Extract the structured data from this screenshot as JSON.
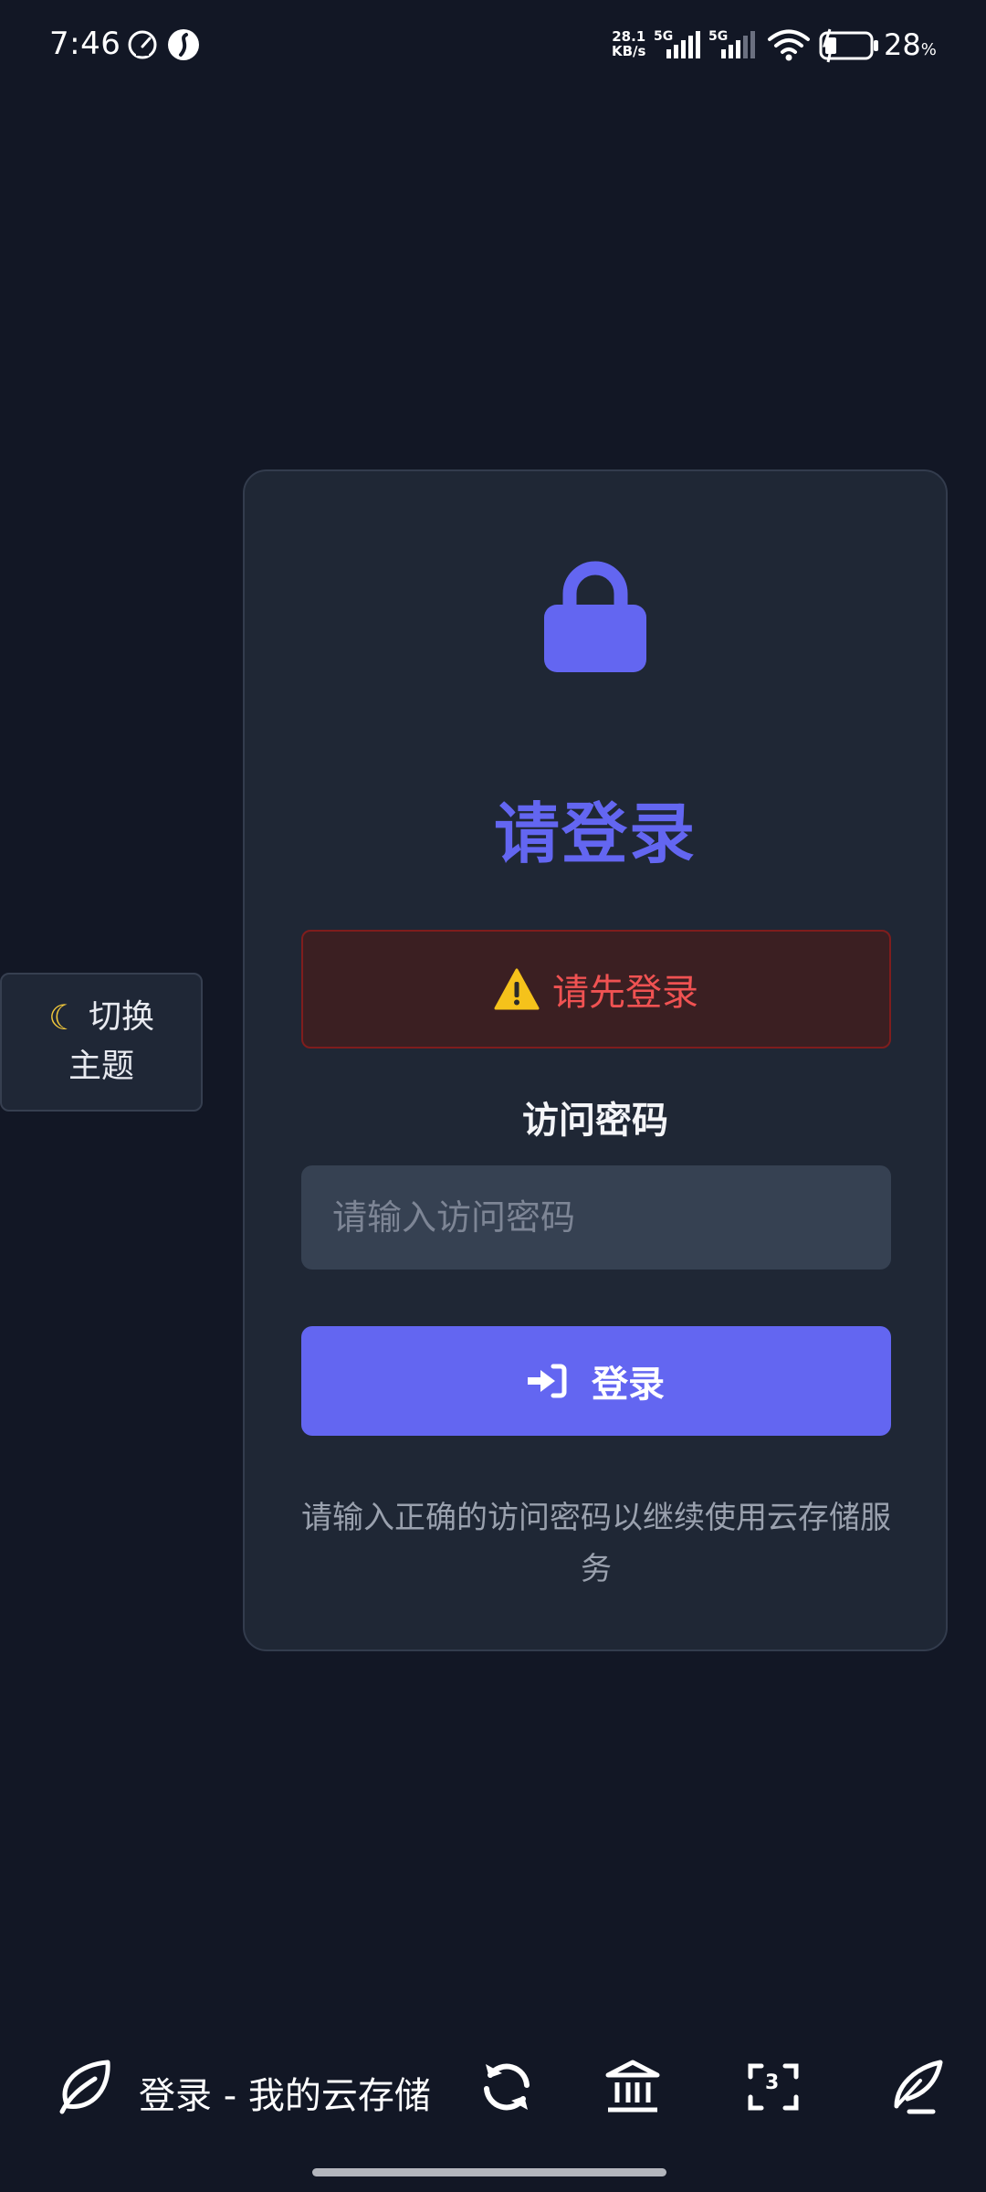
{
  "status_bar": {
    "time": "7:46",
    "net_speed_value": "28.1",
    "net_speed_unit": "KB/s",
    "sim1_label": "5G",
    "sim2_label": "5G",
    "battery_percent": "28",
    "battery_percent_sign": "%",
    "icons": [
      "speedometer-icon",
      "app-s-icon",
      "signal-icon",
      "wifi-icon",
      "battery-icon"
    ]
  },
  "theme_toggle": {
    "icon": "moon-icon",
    "line1": "切换",
    "line2": "主题"
  },
  "login_card": {
    "icon": "lock-icon",
    "title": "请登录",
    "alert": {
      "icon": "warning-icon",
      "text": "请先登录"
    },
    "password_label": "访问密码",
    "password_placeholder": "请输入访问密码",
    "password_value": "",
    "submit_label": "登录",
    "submit_icon": "sign-in-icon",
    "help_text": "请输入正确的访问密码以继续使用云存储服务"
  },
  "browser_bar": {
    "site_icon": "leaf-icon",
    "page_title": "登录 - 我的云存储",
    "tab_count": "3",
    "icons": [
      "refresh-icon",
      "bank-icon",
      "tabs-icon",
      "quill-icon"
    ]
  },
  "colors": {
    "background": "#121725",
    "card": "#1f2735",
    "accent": "#6366f1",
    "error": "#f05252",
    "input_bg": "#364152"
  }
}
